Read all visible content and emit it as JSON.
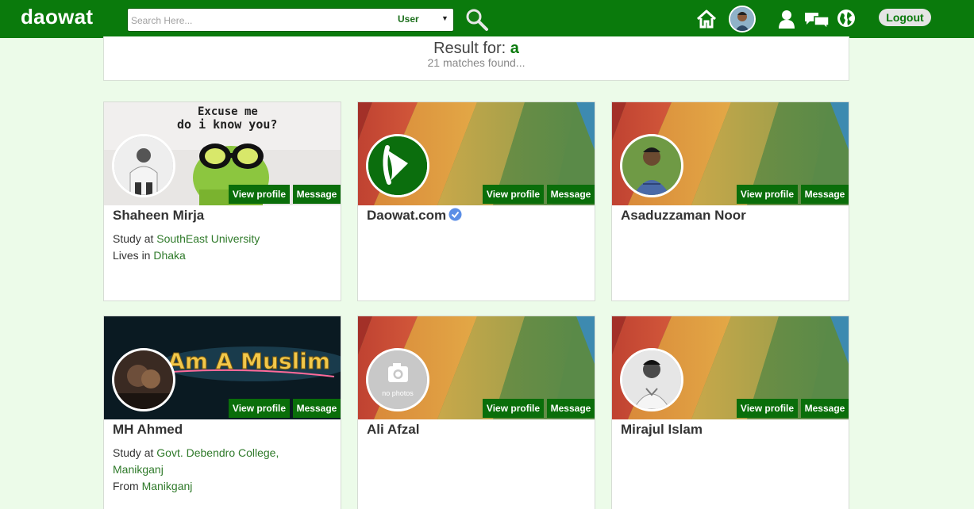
{
  "header": {
    "logo": "daowat",
    "search": {
      "placeholder": "Search Here...",
      "type_selected": "User"
    },
    "logout_label": "Logout",
    "icons": [
      "search-icon",
      "home-icon",
      "user-icon",
      "messages-icon",
      "globe-icon"
    ],
    "accent_color": "#0a7a0c"
  },
  "result": {
    "label": "Result for:",
    "query": "a",
    "count_text": "21 matches found..."
  },
  "cards": [
    {
      "name": "Shaheen Mirja",
      "line1_prefix": "Study at",
      "line1_link": "SouthEast University",
      "line2_prefix": "Lives in",
      "line2_link": "Dhaka",
      "cover_text": [
        "Excuse me",
        "do i know you?"
      ],
      "view_label": "View profile",
      "message_label": "Message"
    },
    {
      "name": "Daowat.com",
      "verified": true,
      "view_label": "View profile",
      "message_label": "Message"
    },
    {
      "name": "Asaduzzaman Noor",
      "view_label": "View profile",
      "message_label": "Message"
    },
    {
      "name": "MH Ahmed",
      "line1_prefix": "Study at",
      "line1_link": "Govt. Debendro College, Manikganj",
      "line2_prefix": "From",
      "line2_link": "Manikganj",
      "cover_text": [
        "I Am A Muslim"
      ],
      "view_label": "View profile",
      "message_label": "Message"
    },
    {
      "name": "Ali Afzal",
      "avatar_text": "no photos",
      "view_label": "View profile",
      "message_label": "Message"
    },
    {
      "name": "Mirajul Islam",
      "view_label": "View profile",
      "message_label": "Message"
    }
  ]
}
